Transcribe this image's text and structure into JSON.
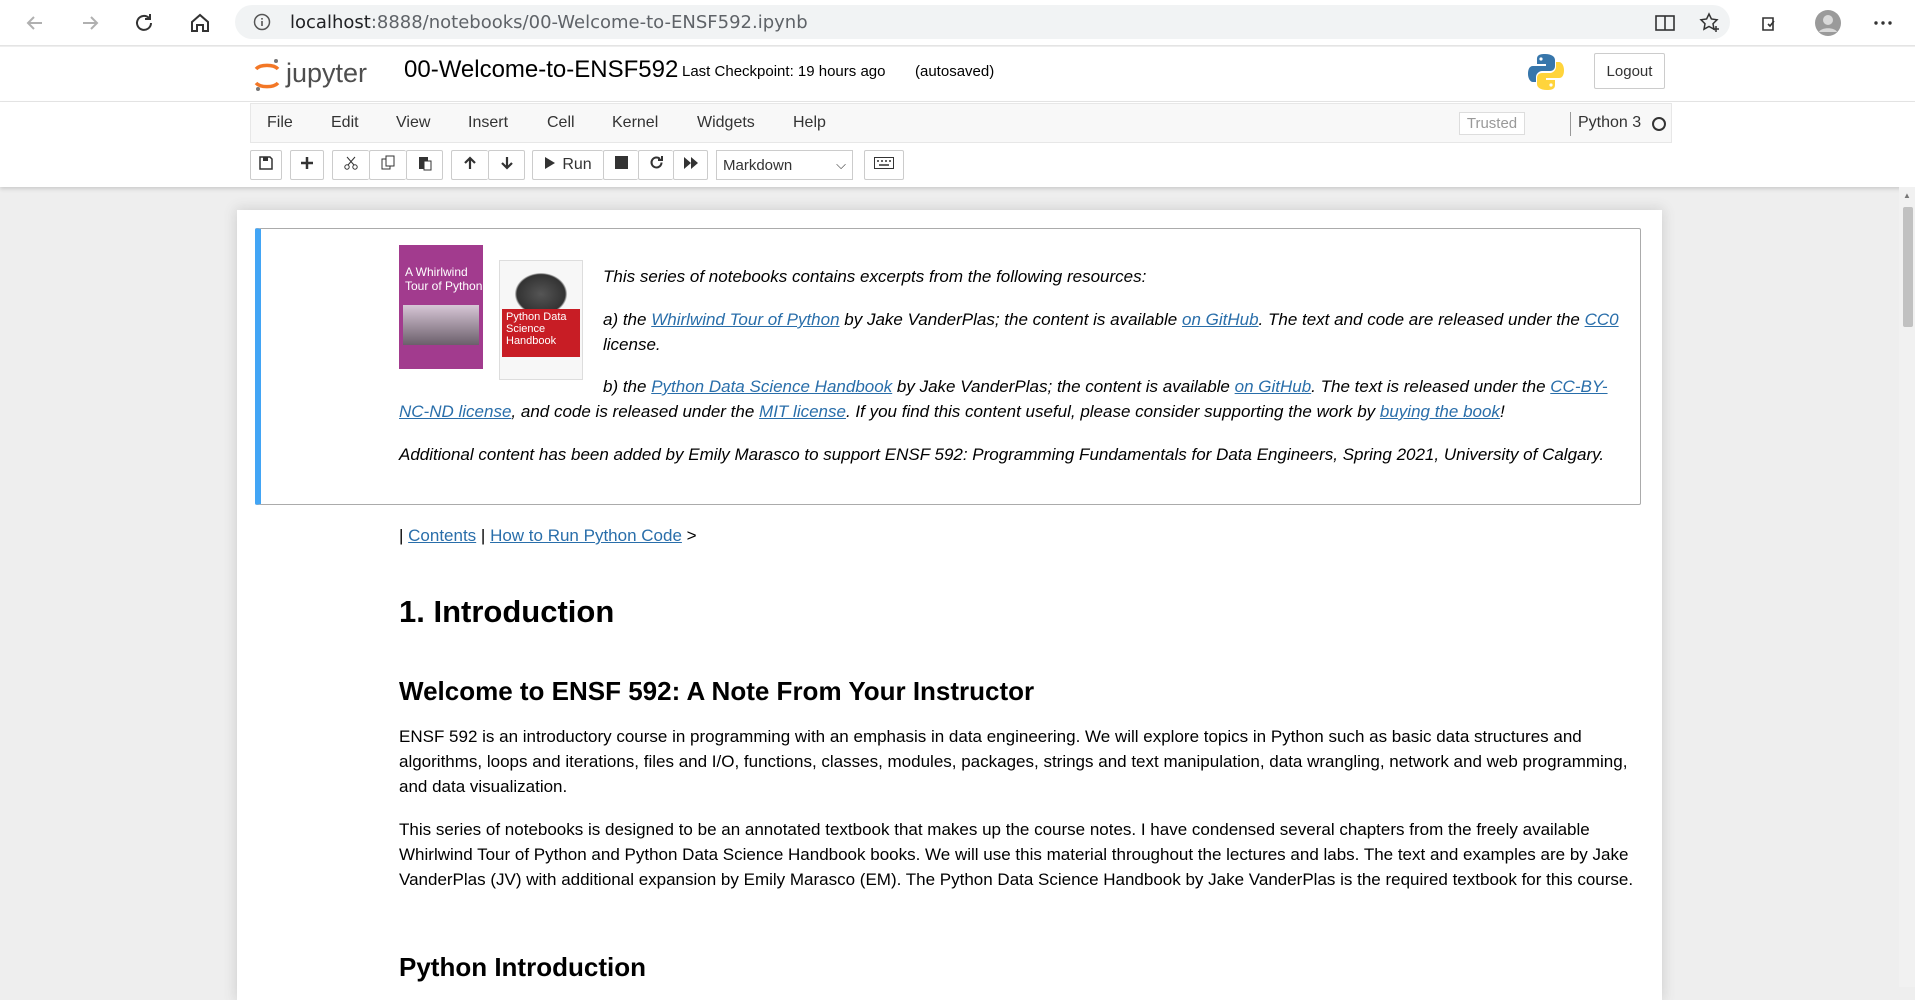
{
  "browser": {
    "url_host": "localhost",
    "url_rest": ":8888/notebooks/00-Welcome-to-ENSF592.ipynb"
  },
  "header": {
    "logo_text": "jupyter",
    "notebook_name": "00-Welcome-to-ENSF592",
    "checkpoint": "Last Checkpoint: 19 hours ago",
    "autosave": "(autosaved)",
    "logout_label": "Logout"
  },
  "menubar": {
    "items": [
      "File",
      "Edit",
      "View",
      "Insert",
      "Cell",
      "Kernel",
      "Widgets",
      "Help"
    ],
    "trusted": "Trusted",
    "kernel": "Python 3"
  },
  "toolbar": {
    "run_label": "Run",
    "cell_type": "Markdown"
  },
  "cell1": {
    "book1_title": "A Whirlwind Tour of Python",
    "book2_title": "Python Data Science Handbook",
    "intro": "This series of notebooks contains excerpts from the following resources:",
    "a_prefix": "a) the ",
    "a_link1": "Whirlwind Tour of Python",
    "a_mid": " by Jake VanderPlas; the content is available ",
    "a_link2": "on GitHub",
    "a_after": ". The text and code are released under the ",
    "a_link3": "CC0",
    "a_end": " license.",
    "b_prefix": "b) the ",
    "b_link1": "Python Data Science Handbook",
    "b_mid": " by Jake VanderPlas; the content is available ",
    "b_link2": "on GitHub",
    "b_after": ". The text is released under the ",
    "b_link3": "CC-BY-NC-ND license",
    "b_mid2": ", and code is released under the ",
    "b_link4": "MIT license",
    "b_mid3": ". If you find this content useful, please consider supporting the work by ",
    "b_link5": "buying the book",
    "b_end": "!",
    "additional": "Additional content has been added by Emily Marasco to support ENSF 592: Programming Fundamentals for Data Engineers, Spring 2021, University of Calgary."
  },
  "nav": {
    "pipe1": "| ",
    "contents": "Contents",
    "pipe2": " | ",
    "howto": "How to Run Python Code",
    "arrow": " >"
  },
  "content": {
    "h1": "1. Introduction",
    "h2a": "Welcome to ENSF 592: A Note From Your Instructor",
    "p1": "ENSF 592 is an introductory course in programming with an emphasis in data engineering. We will explore topics in Python such as basic data structures and algorithms, loops and iterations, files and I/O, functions, classes, modules, packages, strings and text manipulation, data wrangling, network and web programming, and data visualization.",
    "p2": "This series of notebooks is designed to be an annotated textbook that makes up the course notes. I have condensed several chapters from the freely available Whirlwind Tour of Python and Python Data Science Handbook books. We will use this material throughout the lectures and labs. The text and examples are by Jake VanderPlas (JV) with additional expansion by Emily Marasco (EM). The Python Data Science Handbook by Jake VanderPlas is the required textbook for this course.",
    "h2b": "Python Introduction"
  }
}
